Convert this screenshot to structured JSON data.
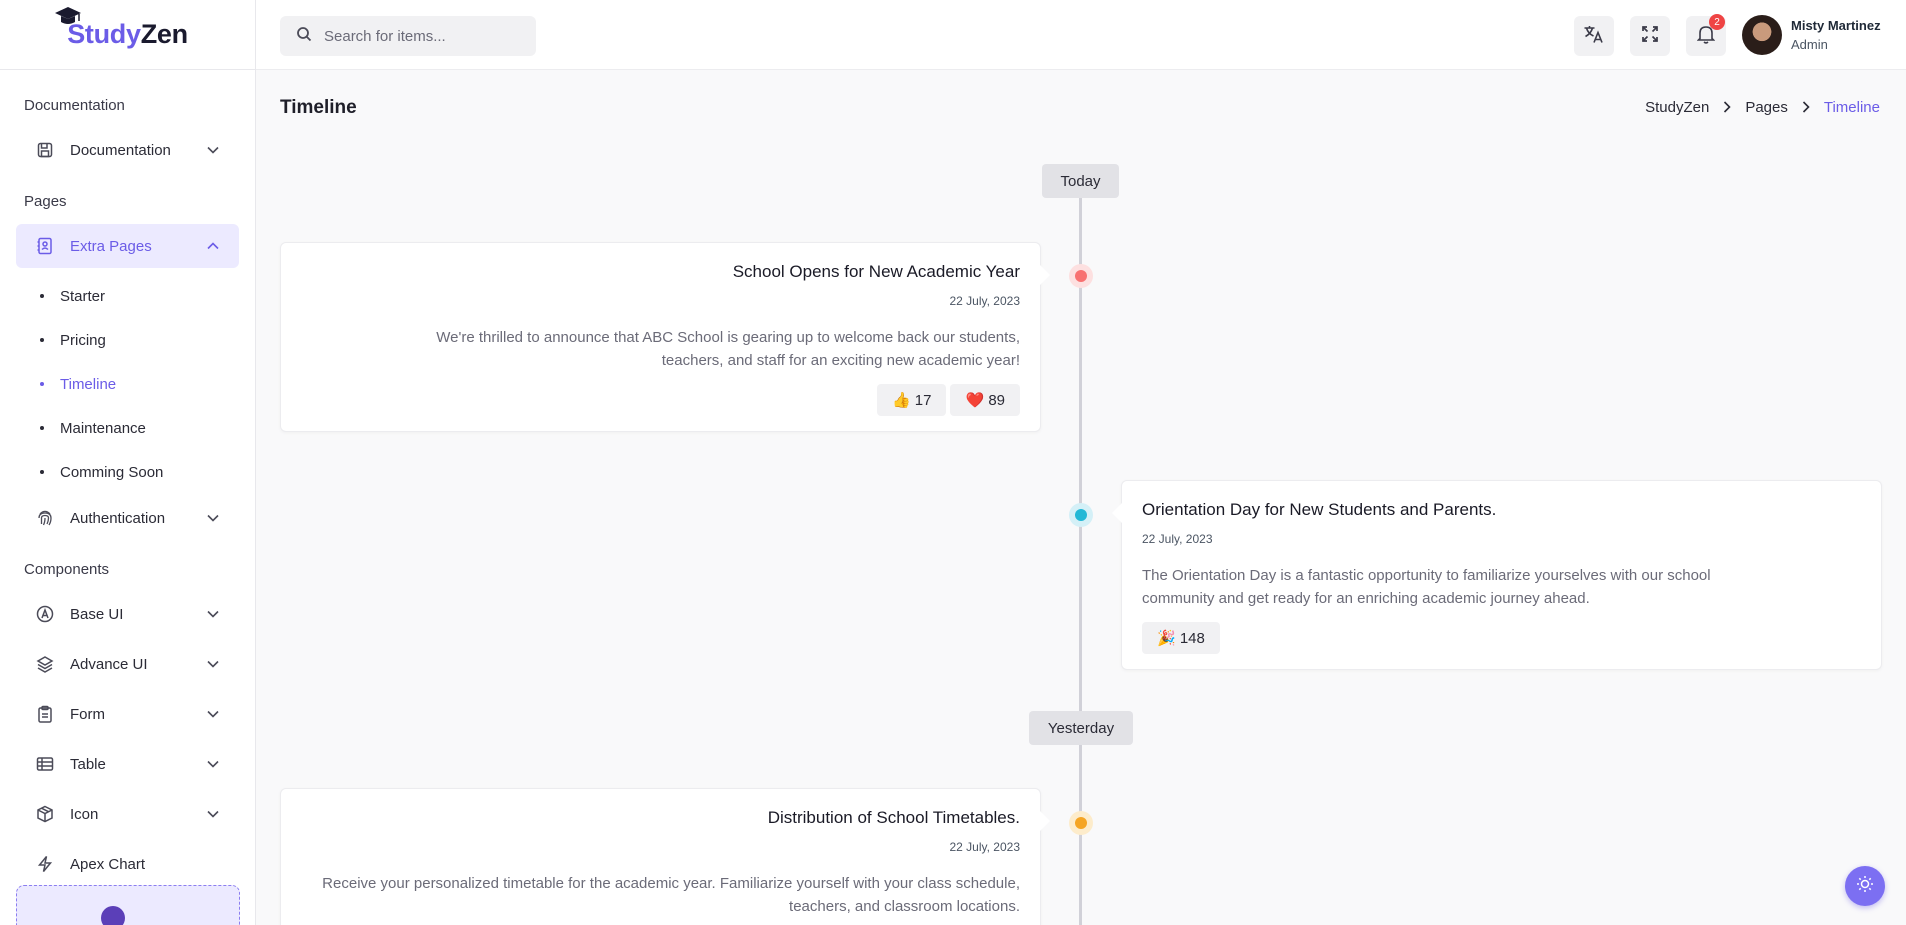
{
  "brand": {
    "part1": "Study",
    "part2": "Zen"
  },
  "sidebar": {
    "sections": [
      "Documentation",
      "Pages",
      "Components"
    ],
    "documentation": {
      "label": "Documentation",
      "icon": "document-icon"
    },
    "extra_pages": {
      "label": "Extra Pages",
      "icon": "contact-book-icon"
    },
    "sub_items": [
      "Starter",
      "Pricing",
      "Timeline",
      "Maintenance",
      "Comming Soon"
    ],
    "authentication": {
      "label": "Authentication",
      "icon": "fingerprint-icon"
    },
    "components": [
      {
        "label": "Base UI",
        "icon": "base-ui-icon"
      },
      {
        "label": "Advance UI",
        "icon": "layers-icon"
      },
      {
        "label": "Form",
        "icon": "clipboard-icon"
      },
      {
        "label": "Table",
        "icon": "table-icon"
      },
      {
        "label": "Icon",
        "icon": "box-icon"
      },
      {
        "label": "Apex Chart",
        "icon": "lightning-icon"
      }
    ]
  },
  "header": {
    "search_placeholder": "Search for items...",
    "notification_count": "2",
    "user": {
      "name": "Misty Martinez",
      "role": "Admin"
    }
  },
  "page": {
    "title": "Timeline",
    "breadcrumb": [
      "StudyZen",
      "Pages",
      "Timeline"
    ]
  },
  "timeline": {
    "groups": [
      "Today",
      "Yesterday"
    ],
    "events": [
      {
        "title": "School Opens for New Academic Year",
        "date": "22 July, 2023",
        "text": "We're thrilled to announce that ABC School is gearing up to welcome back our students, teachers, and staff for an exciting new academic year!",
        "reactions": [
          "👍 17",
          "❤️ 89"
        ],
        "dot_color": "#f87171"
      },
      {
        "title": "Orientation Day for New Students and Parents.",
        "date": "22 July, 2023",
        "text": "The Orientation Day is a fantastic opportunity to familiarize yourselves with our school community and get ready for an enriching academic journey ahead.",
        "reactions": [
          "🎉 148"
        ],
        "dot_color": "#22b8d6"
      },
      {
        "title": "Distribution of School Timetables.",
        "date": "22 July, 2023",
        "text": "Receive your personalized timetable for the academic year. Familiarize yourself with your class schedule, teachers, and classroom locations.",
        "reactions": [],
        "dot_color": "#f5a524"
      }
    ]
  },
  "colors": {
    "accent": "#6b5ce7",
    "accent_light": "#eceaff"
  }
}
